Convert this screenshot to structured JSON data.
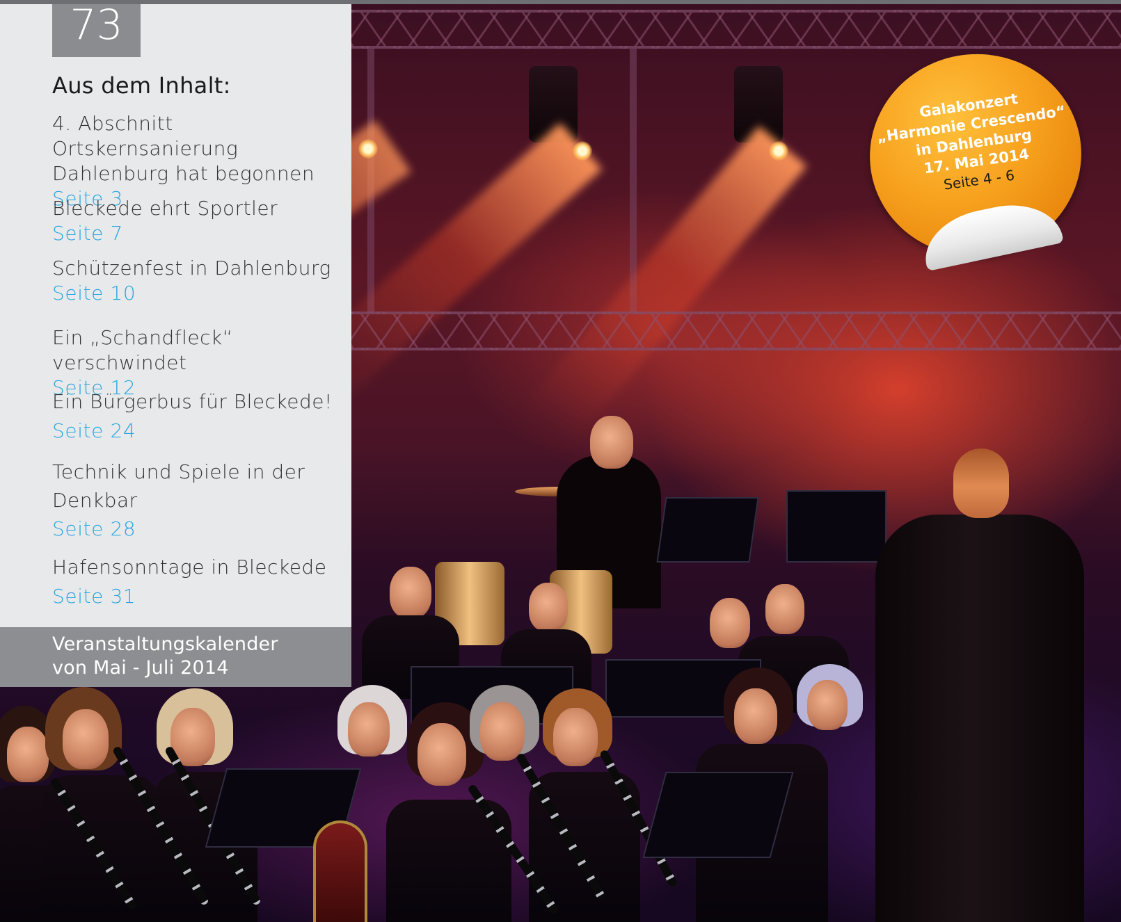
{
  "issue_number": "73",
  "toc": {
    "heading": "Aus dem Inhalt:",
    "items": [
      {
        "title_lines": [
          "4. Abschnitt Ortskernsanierung",
          "Dahlenburg hat begonnen"
        ],
        "page": "Seite 3"
      },
      {
        "title_lines": [
          "Bleckede ehrt Sportler"
        ],
        "page": "Seite 7"
      },
      {
        "title_lines": [
          "Schützenfest in Dahlenburg"
        ],
        "page": "Seite 10"
      },
      {
        "title_lines": [
          "Ein „Schandfleck“ verschwindet"
        ],
        "page": "Seite 12"
      },
      {
        "title_lines": [
          "Ein Bürgerbus für Bleckede!"
        ],
        "page": "Seite 24"
      },
      {
        "title_lines": [
          "Technik und Spiele in der",
          "Denkbar"
        ],
        "page": "Seite 28"
      },
      {
        "title_lines": [
          "Hafensonntage in Bleckede"
        ],
        "page": "Seite 31"
      }
    ]
  },
  "calendar": {
    "line1": "Veranstaltungskalender",
    "line2": "von Mai - Juli 2014"
  },
  "sticker": {
    "line1": "Galakonzert",
    "line2": "„Harmonie Crescendo“",
    "line3": "in Dahlenburg",
    "line4": "17. Mai 2014",
    "line5": "Seite 4 - 6"
  },
  "colors": {
    "panel_bg": "#e8e9eb",
    "issue_box": "#8b8c8f",
    "page_ref": "#29a6df",
    "sticker_orange": "#f7a11e"
  }
}
